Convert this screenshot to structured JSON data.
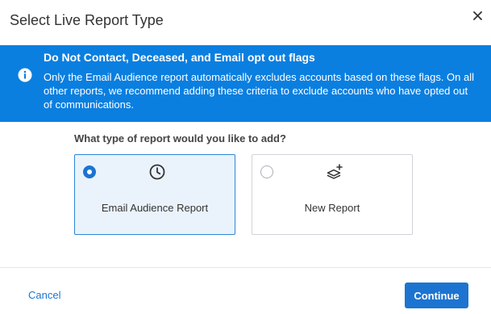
{
  "dialog": {
    "title": "Select Live Report Type"
  },
  "banner": {
    "title": "Do Not Contact, Deceased, and Email opt out flags",
    "text": "Only the Email Audience report automatically excludes accounts based on these flags. On all other reports, we recommend adding these criteria to exclude accounts who have opted out of communications.",
    "color": "#0a7fe0",
    "icon": "info-icon"
  },
  "question": "What type of report would you like to add?",
  "options": [
    {
      "label": "Email Audience Report",
      "icon": "clock-icon",
      "selected": true
    },
    {
      "label": "New Report",
      "icon": "layers-plus-icon",
      "selected": false
    }
  ],
  "footer": {
    "cancel_label": "Cancel",
    "continue_label": "Continue"
  },
  "colors": {
    "accent": "#1c74d0",
    "selected_card_bg": "#eaf3fc"
  }
}
